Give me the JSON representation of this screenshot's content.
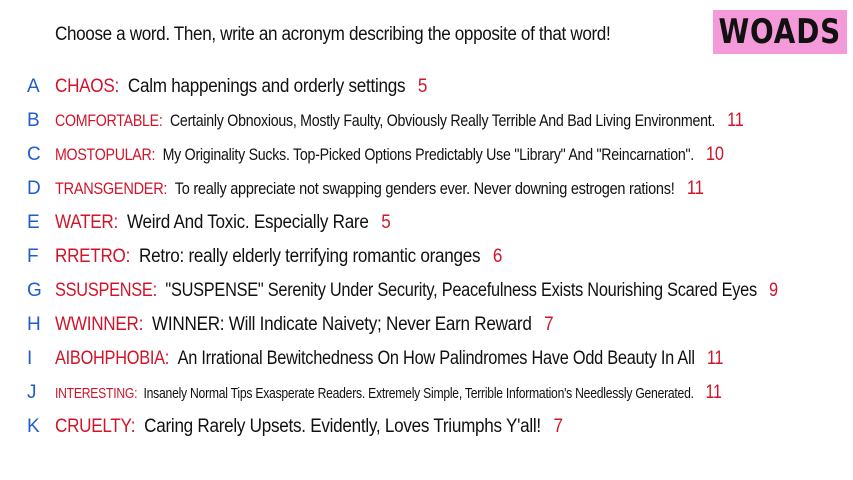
{
  "header": {
    "prompt": "Choose a word. Then, write an acronym describing the opposite of that word!",
    "logo": "WOADS"
  },
  "colors": {
    "letter": "#1f5ec9",
    "word": "#d0142a",
    "score": "#d0142a",
    "logo_bg": "#f59ad9"
  },
  "entries": [
    {
      "letter": "A",
      "word": "CHAOS",
      "definition": "Calm happenings and orderly settings",
      "score": "5"
    },
    {
      "letter": "B",
      "word": "COMFORTABLE",
      "definition": "Certainly Obnoxious, Mostly Faulty, Obviously Really Terrible And Bad Living Environment.",
      "score": "11"
    },
    {
      "letter": "C",
      "word": "MOSTOPULAR",
      "definition": "My Originality Sucks. Top-Picked Options Predictably Use \"Library\" And \"Reincarnation\".",
      "score": "10"
    },
    {
      "letter": "D",
      "word": "TRANSGENDER",
      "definition": "To really appreciate not swapping genders ever. Never downing estrogen rations!",
      "score": "11"
    },
    {
      "letter": "E",
      "word": "WATER",
      "definition": "Weird And Toxic. Especially Rare",
      "score": "5"
    },
    {
      "letter": "F",
      "word": "RRETRO",
      "definition": "Retro: really elderly terrifying romantic oranges",
      "score": "6"
    },
    {
      "letter": "G",
      "word": "SSUSPENSE",
      "definition": "\"SUSPENSE\" Serenity Under Security, Peacefulness Exists Nourishing Scared Eyes",
      "score": "9"
    },
    {
      "letter": "H",
      "word": "WWINNER",
      "definition": "WINNER: Will Indicate Naivety; Never Earn Reward",
      "score": "7"
    },
    {
      "letter": "I",
      "word": "AIBOHPHOBIA",
      "definition": "An Irrational Bewitchedness On How Palindromes Have Odd Beauty In All",
      "score": "11"
    },
    {
      "letter": "J",
      "word": "INTERESTING",
      "definition": "Insanely Normal Tips Exasperate Readers. Extremely Simple, Terrible Information's Needlessly Generated.",
      "score": "11"
    },
    {
      "letter": "K",
      "word": "CRUELTY",
      "definition": "Caring Rarely Upsets. Evidently, Loves Triumphs Y'all!",
      "score": "7"
    }
  ]
}
